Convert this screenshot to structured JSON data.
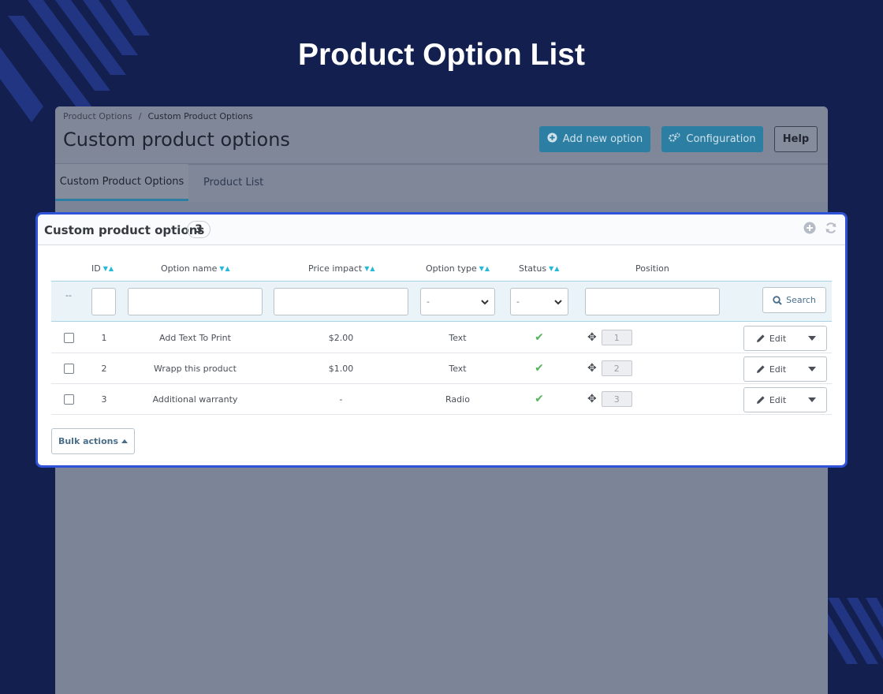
{
  "hero_title": "Product Option List",
  "colors": {
    "page_bg": "#13204f",
    "accent": "#25b9d7",
    "highlight_border": "#2f53d8",
    "primary_button": "#2d7ea3",
    "status_ok": "#59b25c"
  },
  "admin": {
    "breadcrumb": [
      "Product Options",
      "Custom Product Options"
    ],
    "breadcrumb_sep": "/",
    "title": "Custom product options",
    "toolbar": {
      "add_label": "Add new option",
      "config_label": "Configuration",
      "help_label": "Help"
    },
    "tabs": [
      {
        "label": "Custom Product Options",
        "active": true
      },
      {
        "label": "Product List",
        "active": false
      }
    ]
  },
  "card": {
    "title": "Custom product options",
    "count": "3",
    "icons": [
      "add-circle-icon",
      "refresh-icon"
    ]
  },
  "table": {
    "columns": [
      "ID",
      "Option name",
      "Price impact",
      "Option type",
      "Status",
      "Position"
    ],
    "filters": {
      "dash": "--",
      "type_value": "-",
      "status_value": "-",
      "search_label": "Search"
    },
    "rows": [
      {
        "id": "1",
        "name": "Add Text To Print",
        "price": "$2.00",
        "type": "Text",
        "position": "1",
        "edit": "Edit"
      },
      {
        "id": "2",
        "name": "Wrapp this product",
        "price": "$1.00",
        "type": "Text",
        "position": "2",
        "edit": "Edit"
      },
      {
        "id": "3",
        "name": "Additional warranty",
        "price": "-",
        "type": "Radio",
        "position": "3",
        "edit": "Edit"
      }
    ]
  },
  "bulk_actions_label": "Bulk actions"
}
